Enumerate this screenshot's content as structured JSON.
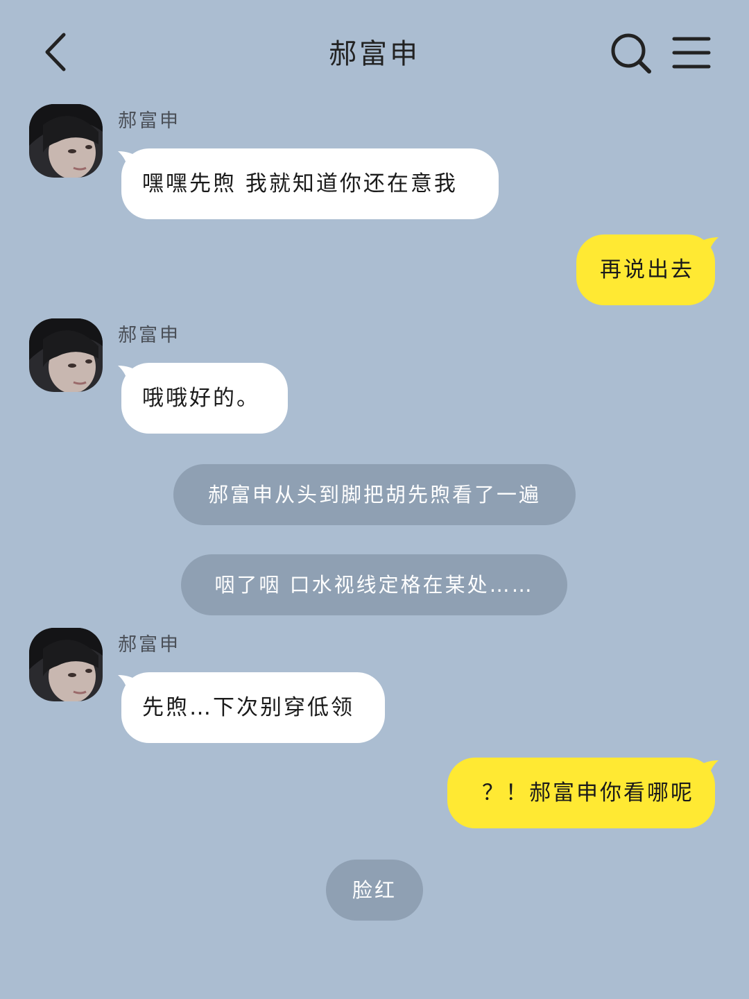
{
  "header": {
    "title": "郝富申",
    "icons": [
      "back-chevron-icon",
      "search-icon",
      "menu-icon"
    ]
  },
  "colors": {
    "background": "#abbdd1",
    "incoming_bubble": "#ffffff",
    "outgoing_bubble": "#ffe933",
    "narration_pill": "#8fa0b3"
  },
  "messages": [
    {
      "type": "incoming",
      "sender": "郝富申",
      "text": "嘿嘿先煦 我就知道你还在意我"
    },
    {
      "type": "outgoing",
      "text": "再说出去"
    },
    {
      "type": "incoming",
      "sender": "郝富申",
      "text": "哦哦好的。"
    },
    {
      "type": "narration",
      "text": "郝富申从头到脚把胡先煦看了一遍"
    },
    {
      "type": "narration",
      "text": "咽了咽 口水视线定格在某处……"
    },
    {
      "type": "incoming",
      "sender": "郝富申",
      "text": "先煦…下次别穿低领"
    },
    {
      "type": "outgoing",
      "text": "？！郝富申你看哪呢"
    },
    {
      "type": "narration",
      "text": "脸红"
    }
  ]
}
